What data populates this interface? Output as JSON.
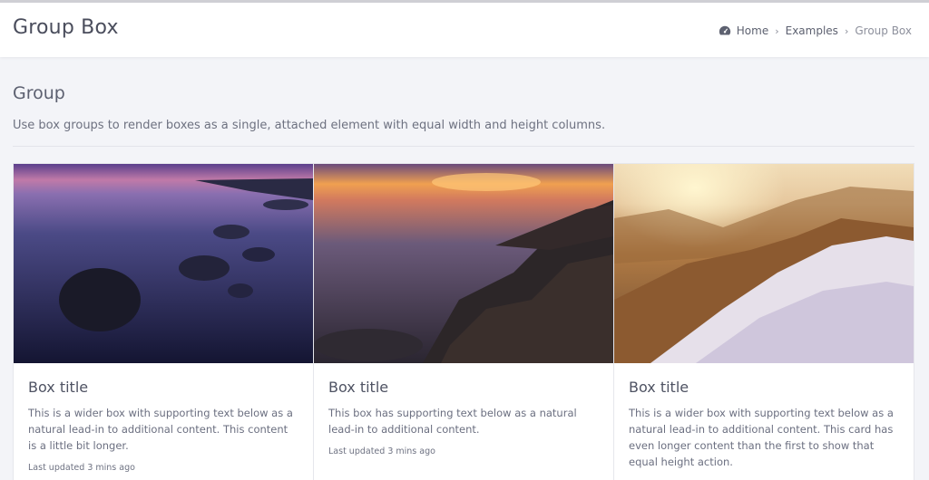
{
  "header": {
    "title": "Group Box"
  },
  "breadcrumb": {
    "items": [
      "Home",
      "Examples",
      "Group Box"
    ],
    "icon": "dashboard-icon"
  },
  "section": {
    "title": "Group",
    "description": "Use box groups to render boxes as a single, attached element with equal width and height columns."
  },
  "boxes": [
    {
      "title": "Box title",
      "text": "This is a wider box with supporting text below as a natural lead-in to additional content. This content is a little bit longer.",
      "meta": "Last updated 3 mins ago"
    },
    {
      "title": "Box title",
      "text": "This box has supporting text below as a natural lead-in to additional content.",
      "meta": "Last updated 3 mins ago"
    },
    {
      "title": "Box title",
      "text": "This is a wider box with supporting text below as a natural lead-in to additional content. This card has even longer content than the first to show that equal height action.",
      "meta": ""
    }
  ],
  "colors": {
    "accent": "#4a4d5c",
    "background": "#f3f4f8"
  }
}
